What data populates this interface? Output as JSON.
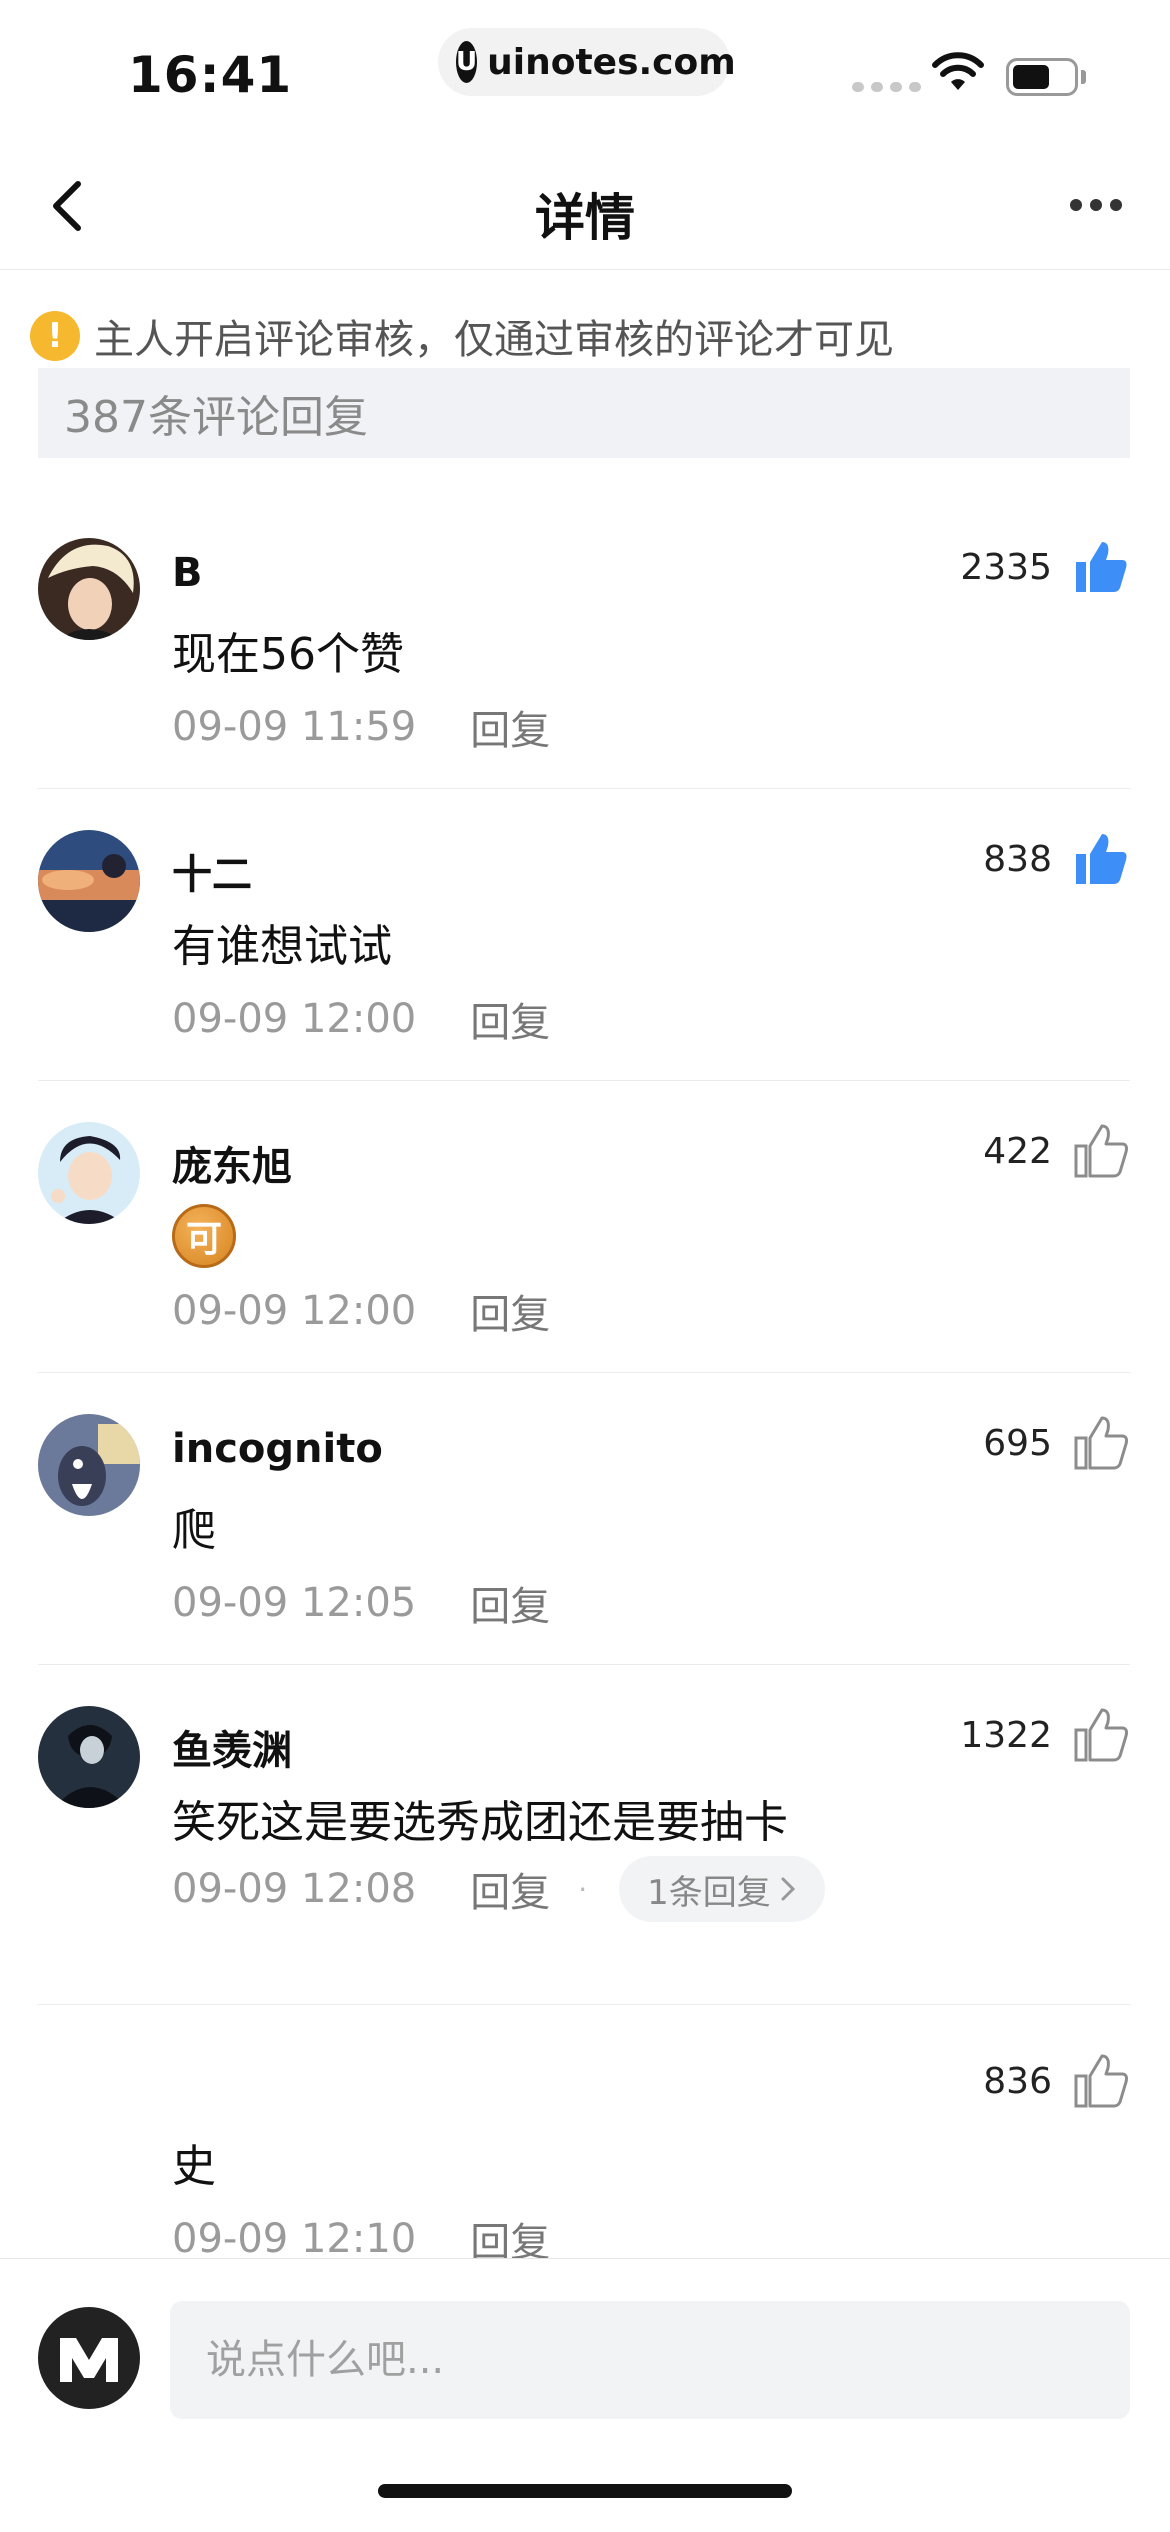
{
  "status_bar": {
    "time": "16:41",
    "url": "uinotes.com",
    "logo_letter": "U"
  },
  "nav": {
    "title": "详情",
    "back_icon": "chevron-left-icon",
    "more_icon": "more-dots-icon"
  },
  "notice": {
    "icon_text": "!",
    "text": "主人开启评论审核，仅通过审核的评论才可见"
  },
  "comment_count": "387条评论回复",
  "colors": {
    "like_active": "#3e8ef7",
    "like_inactive": "#8c8c8c",
    "warning": "#f5b82e"
  },
  "comments": [
    {
      "username": "B",
      "likes": "2335",
      "liked": true,
      "text": "现在56个赞",
      "time": "09-09 11:59",
      "reply_label": "回复"
    },
    {
      "username": "十二",
      "likes": "838",
      "liked": true,
      "text": "有谁想试试",
      "time": "09-09 12:00",
      "reply_label": "回复"
    },
    {
      "username": "庞东旭",
      "likes": "422",
      "liked": false,
      "emoji": "可",
      "time": "09-09 12:00",
      "reply_label": "回复"
    },
    {
      "username": "incognito",
      "likes": "695",
      "liked": false,
      "text": "爬",
      "time": "09-09 12:05",
      "reply_label": "回复"
    },
    {
      "username": "鱼羡渊",
      "likes": "1322",
      "liked": false,
      "text": "笑死这是要选秀成团还是要抽卡",
      "time": "09-09 12:08",
      "reply_label": "回复",
      "dot": "·",
      "reply_count": "1条回复"
    },
    {
      "likes": "836",
      "liked": false,
      "text": "史",
      "time": "09-09 12:10",
      "reply_label": "回复"
    }
  ],
  "bottom_bar": {
    "input_placeholder": "说点什么吧..."
  }
}
